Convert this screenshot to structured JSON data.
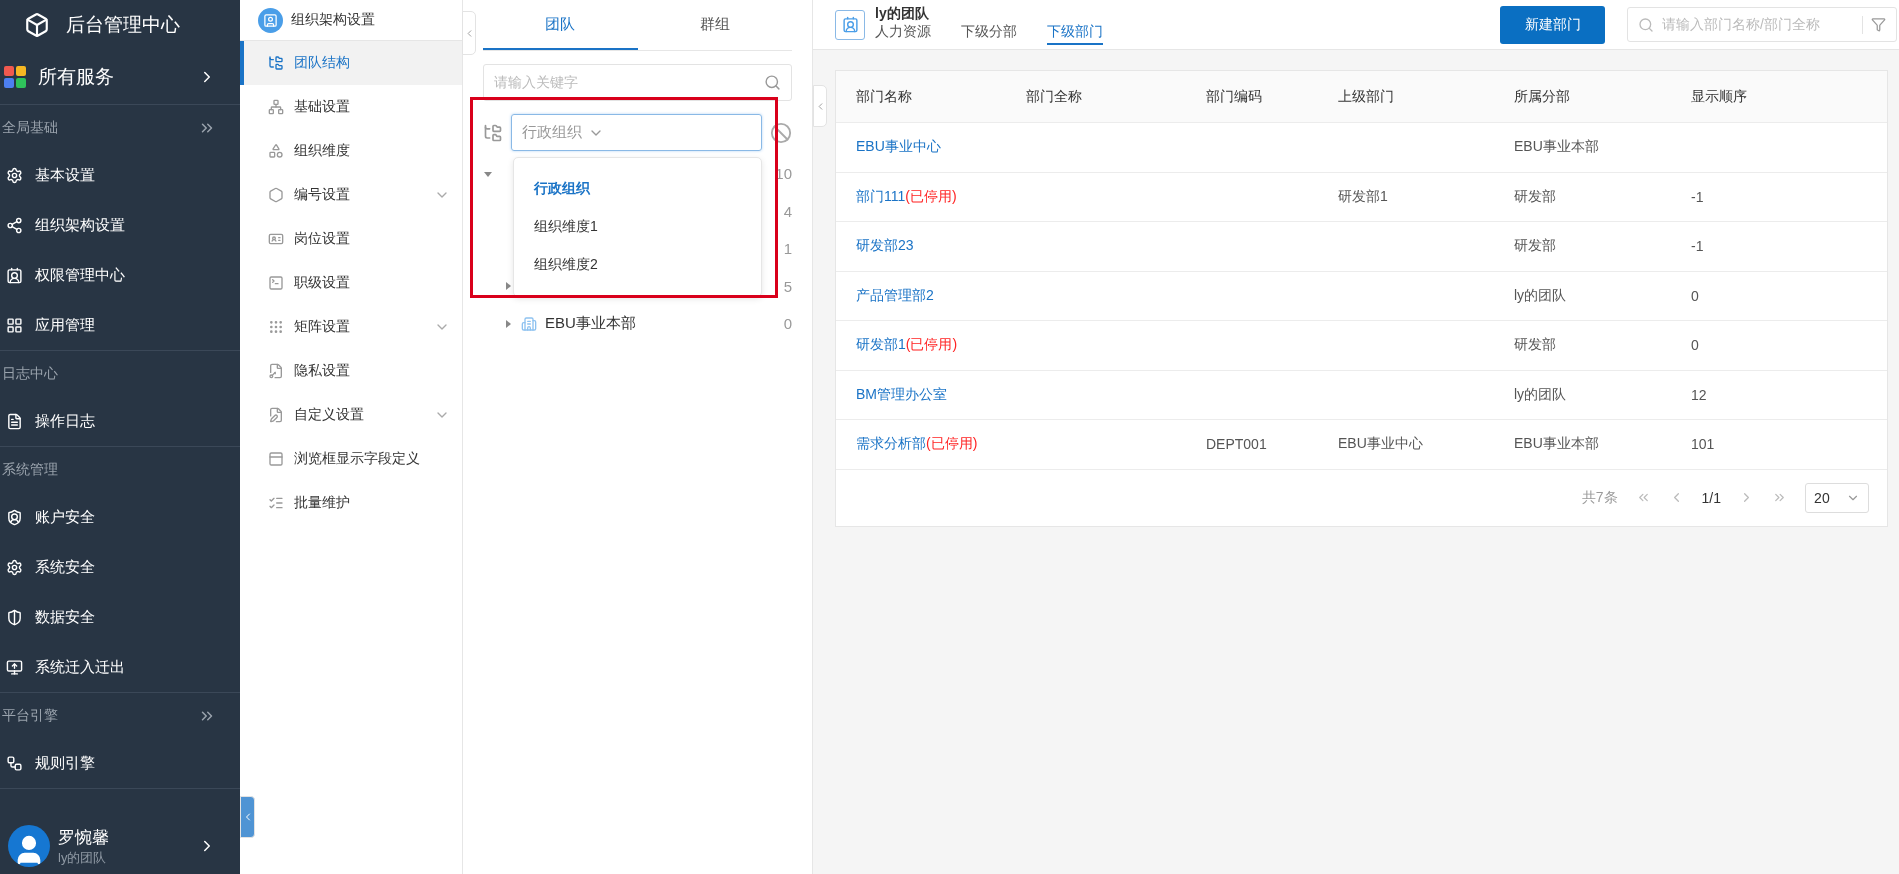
{
  "nav": {
    "title": "后台管理中心",
    "all_services": "所有服务",
    "sections": [
      {
        "title": "全局基础",
        "collapsible": true,
        "items": [
          {
            "label": "基本设置"
          },
          {
            "label": "组织架构设置"
          },
          {
            "label": "权限管理中心"
          },
          {
            "label": "应用管理"
          }
        ]
      },
      {
        "title": "日志中心",
        "collapsible": false,
        "items": [
          {
            "label": "操作日志"
          }
        ]
      },
      {
        "title": "系统管理",
        "collapsible": false,
        "items": [
          {
            "label": "账户安全"
          },
          {
            "label": "系统安全"
          },
          {
            "label": "数据安全"
          },
          {
            "label": "系统迁入迁出"
          }
        ]
      },
      {
        "title": "平台引擎",
        "collapsible": true,
        "items": [
          {
            "label": "规则引擎"
          }
        ]
      }
    ],
    "user": {
      "name": "罗惋馨",
      "team": "ly的团队"
    }
  },
  "subnav": {
    "title": "组织架构设置",
    "items": [
      {
        "label": "团队结构",
        "kind": "item",
        "selected": true
      },
      {
        "label": "基础设置",
        "kind": "item",
        "selected": false
      },
      {
        "label": "组织维度",
        "kind": "item",
        "selected": false
      },
      {
        "label": "编号设置",
        "kind": "group",
        "selected": false
      },
      {
        "label": "岗位设置",
        "kind": "item",
        "selected": false
      },
      {
        "label": "职级设置",
        "kind": "item",
        "selected": false
      },
      {
        "label": "矩阵设置",
        "kind": "group",
        "selected": false
      },
      {
        "label": "隐私设置",
        "kind": "item",
        "selected": false
      },
      {
        "label": "自定义设置",
        "kind": "group",
        "selected": false
      },
      {
        "label": "浏览框显示字段定义",
        "kind": "item",
        "selected": false
      },
      {
        "label": "批量维护",
        "kind": "item",
        "selected": false
      }
    ]
  },
  "tree_panel": {
    "tabs": [
      {
        "label": "团队",
        "selected": true
      },
      {
        "label": "群组",
        "selected": false
      }
    ],
    "search": {
      "placeholder": "请输入关键字"
    },
    "dimension_select": {
      "value": "行政组织",
      "expanded": true,
      "options": [
        {
          "label": "行政组织",
          "selected": true
        },
        {
          "label": "组织维度1",
          "selected": false
        },
        {
          "label": "组织维度2",
          "selected": false
        }
      ]
    },
    "tree": [
      {
        "kind": "branch",
        "expanded": true,
        "count": "10",
        "children": [
          {
            "kind": "leaf",
            "count": "4"
          },
          {
            "kind": "leaf",
            "count": "1"
          },
          {
            "kind": "branch",
            "expanded": false,
            "count": "5"
          },
          {
            "kind": "branch",
            "expanded": false,
            "label": "EBU事业本部",
            "count": "0"
          }
        ]
      }
    ]
  },
  "main": {
    "team": "ly的团队",
    "tabs": [
      {
        "label": "人力资源",
        "selected": false
      },
      {
        "label": "下级分部",
        "selected": false
      },
      {
        "label": "下级部门",
        "selected": true
      }
    ],
    "new_button": "新建部门",
    "search": {
      "placeholder": "请输入部门名称/部门全称"
    },
    "table": {
      "columns": [
        "部门名称",
        "部门全称",
        "部门编码",
        "上级部门",
        "所属分部",
        "显示顺序"
      ],
      "rows": [
        {
          "name": "EBU事业中心",
          "branch": "EBU事业本部"
        },
        {
          "name": "部门111",
          "status": "(已停用)",
          "parent": "研发部1",
          "branch": "研发部",
          "order": "-1"
        },
        {
          "name": "研发部23",
          "branch": "研发部",
          "order": "-1"
        },
        {
          "name": "产品管理部2",
          "branch": "ly的团队",
          "order": "0"
        },
        {
          "name": "研发部1",
          "status": "(已停用)",
          "branch": "研发部",
          "order": "0"
        },
        {
          "name": "BM管理办公室",
          "branch": "ly的团队",
          "order": "12"
        },
        {
          "name": "需求分析部",
          "status": "(已停用)",
          "code": "DEPT001",
          "parent": "EBU事业中心",
          "branch": "EBU事业本部",
          "order": "101"
        }
      ]
    },
    "pagination": {
      "total": "共7条",
      "page": "1/1",
      "page_size": "20"
    }
  }
}
